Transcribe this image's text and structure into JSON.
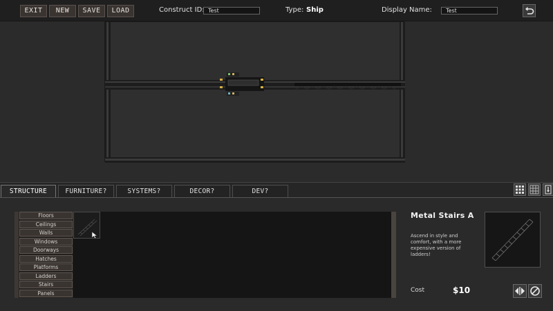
{
  "toolbar": {
    "exit_label": "EXIT",
    "new_label": "NEW",
    "save_label": "SAVE",
    "load_label": "LOAD",
    "construct_id_label": "Construct ID:",
    "construct_id_value": "Test",
    "type_label": "Type:",
    "type_value": "Ship",
    "display_name_label": "Display Name:",
    "display_name_value": "Test",
    "undo_icon": "undo-icon"
  },
  "tabs": [
    {
      "label": "STRUCTURE",
      "active": true
    },
    {
      "label": "FURNITURE?",
      "active": false
    },
    {
      "label": "SYSTEMS?",
      "active": false
    },
    {
      "label": "DECOR?",
      "active": false
    },
    {
      "label": "DEV?",
      "active": false
    }
  ],
  "view_buttons": [
    "grid-large-icon",
    "grid-small-icon",
    "export-icon"
  ],
  "categories": [
    "Floors",
    "Ceilings",
    "Walls",
    "Windows",
    "Doorways",
    "Hatches",
    "Platforms",
    "Ladders",
    "Stairs",
    "Panels"
  ],
  "selected_item": {
    "name": "Metal Stairs A",
    "description": "Ascend in style and comfort, with a more expensive version of ladders!",
    "cost_label": "Cost",
    "cost_value": "$10"
  },
  "actions": [
    "flip-icon",
    "cancel-icon"
  ],
  "colors": {
    "background": "#2b2b2b",
    "button": "#3a3431",
    "button_border": "#5a524d",
    "text": "#e6e6e6"
  }
}
